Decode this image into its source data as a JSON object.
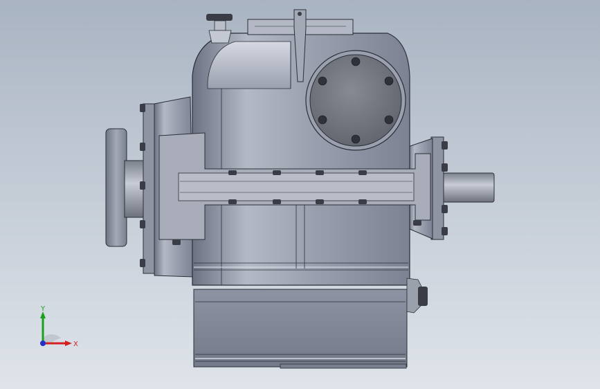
{
  "viewport": {
    "background_top": "#a9b4c2",
    "background_bottom": "#dfe4ea"
  },
  "model": {
    "body_color": "#8f96a6",
    "body_highlight": "#c9cdd8",
    "edge_color": "#2b2e36",
    "cover_color": "#6f737c",
    "bolt_color": "#3a3d45"
  },
  "triad": {
    "y_label": "Y",
    "x_label": "X",
    "y_color": "#1aa01a",
    "x_color": "#d42020",
    "z_color": "#2030c8"
  }
}
